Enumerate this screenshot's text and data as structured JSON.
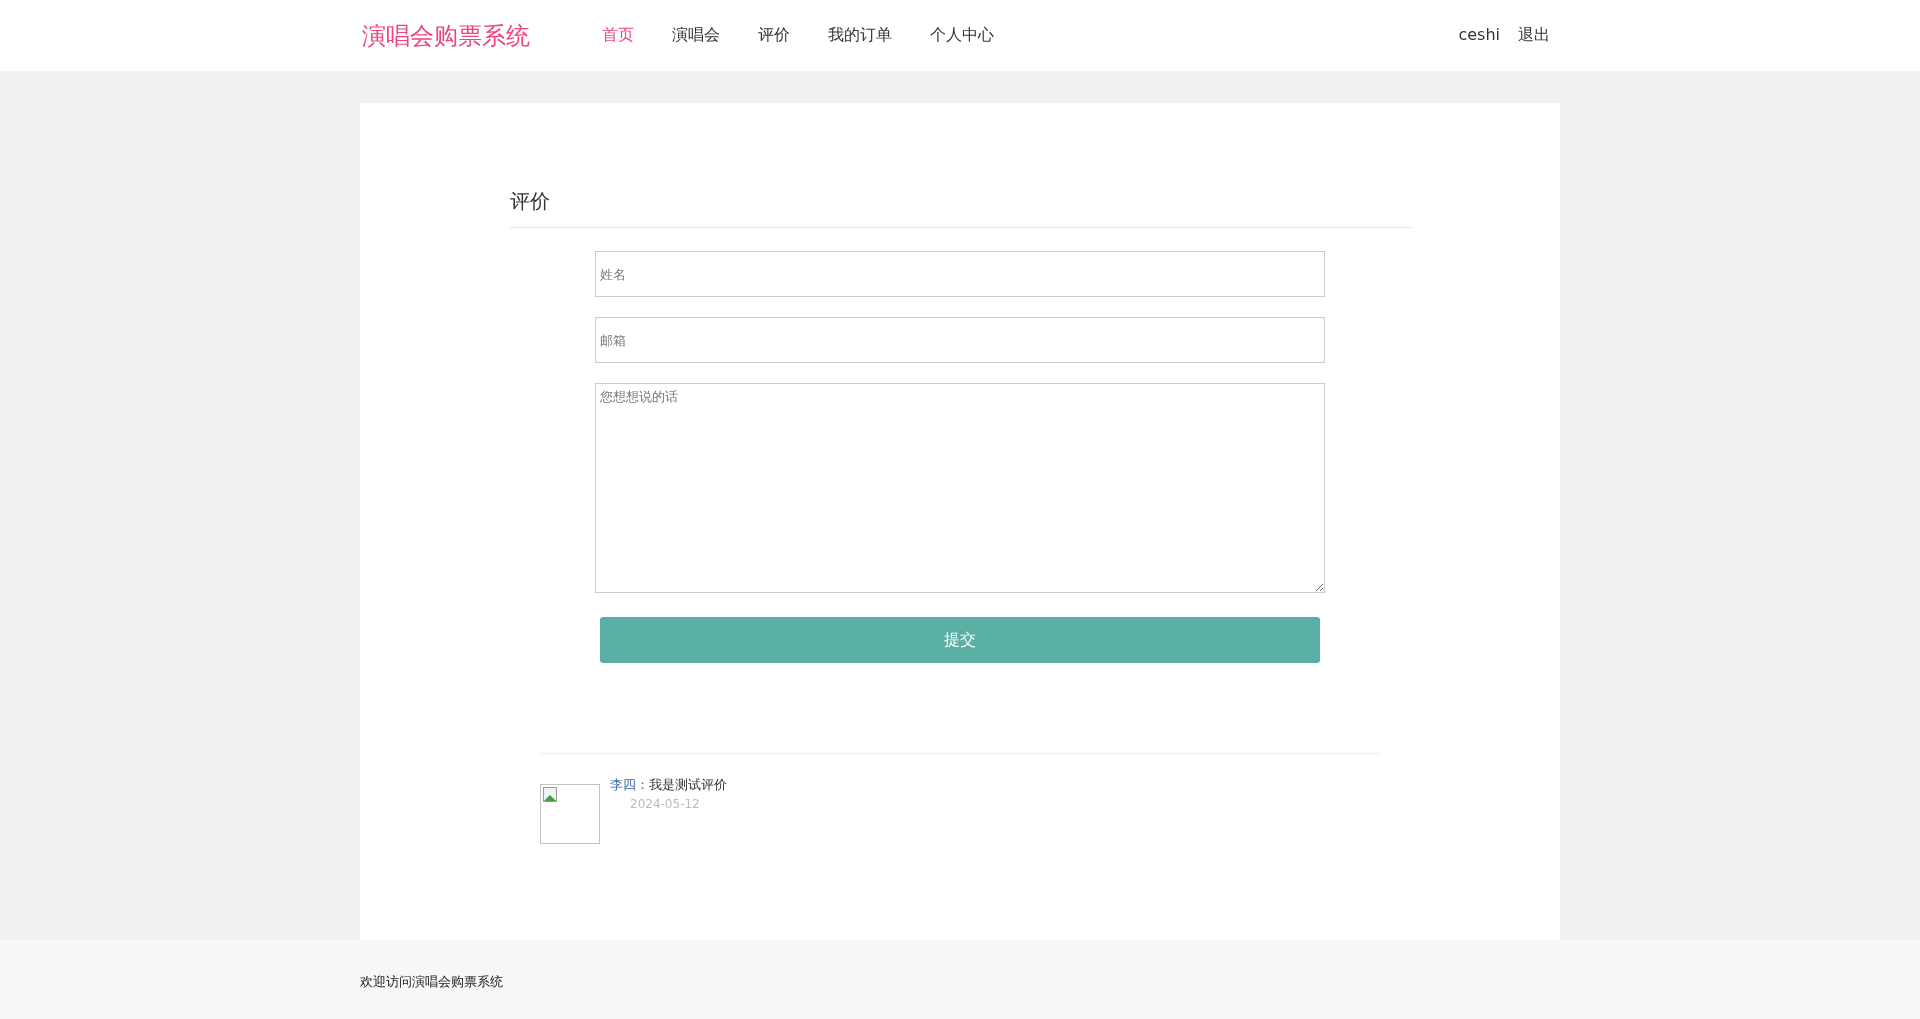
{
  "header": {
    "logo": "演唱会购票系统",
    "nav": [
      {
        "label": "首页",
        "selected": true
      },
      {
        "label": "演唱会",
        "selected": false
      },
      {
        "label": "评价",
        "selected": false
      },
      {
        "label": "我的订单",
        "selected": false
      },
      {
        "label": "个人中心",
        "selected": false
      }
    ],
    "user": "ceshi",
    "logout": "退出"
  },
  "form": {
    "title": "评价",
    "name_placeholder": "姓名",
    "email_placeholder": "邮箱",
    "message_placeholder": "您想想说的话",
    "submit": "提交"
  },
  "comments": [
    {
      "author": "李四",
      "separator": "：",
      "text": "我是测试评价",
      "date": "2024-05-12"
    }
  ],
  "footer": {
    "text": "欢迎访问演唱会购票系统"
  }
}
